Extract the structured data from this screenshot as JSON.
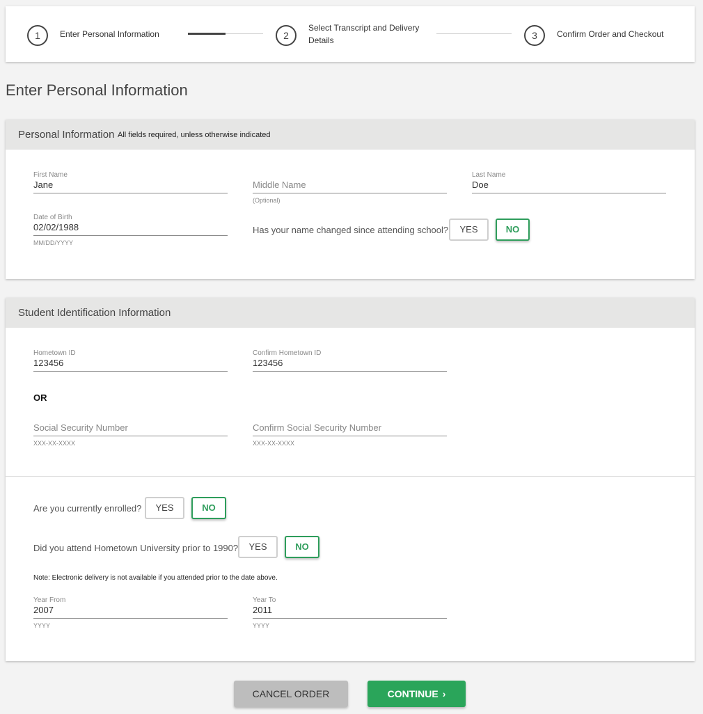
{
  "stepper": {
    "steps": [
      {
        "number": "1",
        "label": "Enter Personal Information"
      },
      {
        "number": "2",
        "label": "Select Transcript and Delivery Details"
      },
      {
        "number": "3",
        "label": "Confirm Order and Checkout"
      }
    ],
    "progress_fraction": 0.5
  },
  "page_title": "Enter Personal Information",
  "personal": {
    "title": "Personal Information",
    "note": "All fields required, unless otherwise indicated",
    "first_name": {
      "label": "First Name",
      "value": "Jane"
    },
    "middle_name": {
      "placeholder": "Middle Name",
      "hint": "(Optional)"
    },
    "last_name": {
      "label": "Last Name",
      "value": "Doe"
    },
    "dob": {
      "label": "Date of Birth",
      "value": "02/02/1988",
      "hint": "MM/DD/YYYY"
    },
    "name_changed": {
      "question": "Has your name changed since attending school?",
      "yes": "YES",
      "no": "NO",
      "selected": "NO"
    }
  },
  "student": {
    "title": "Student Identification Information",
    "hometown_id": {
      "label": "Hometown ID",
      "value": "123456"
    },
    "confirm_hometown_id": {
      "label": "Confirm Hometown ID",
      "value": "123456"
    },
    "or_label": "OR",
    "ssn": {
      "placeholder": "Social Security Number",
      "hint": "XXX-XX-XXXX"
    },
    "confirm_ssn": {
      "placeholder": "Confirm Social Security Number",
      "hint": "XXX-XX-XXXX"
    },
    "enrolled": {
      "question": "Are you currently enrolled?",
      "yes": "YES",
      "no": "NO",
      "selected": "NO"
    },
    "prior_1990": {
      "question": "Did you attend Hometown University prior to 1990?",
      "yes": "YES",
      "no": "NO",
      "selected": "NO"
    },
    "note": "Note: Electronic delivery is not available if you attended prior to the date above.",
    "year_from": {
      "label": "Year From",
      "value": "2007",
      "hint": "YYYY"
    },
    "year_to": {
      "label": "Year To",
      "value": "2011",
      "hint": "YYYY"
    }
  },
  "buttons": {
    "cancel": "CANCEL ORDER",
    "continue": "CONTINUE",
    "continue_icon": "chevron-right-icon"
  },
  "colors": {
    "accent_green": "#2aa55a",
    "header_gray": "#e6e6e5",
    "background": "#f3f3f3"
  }
}
